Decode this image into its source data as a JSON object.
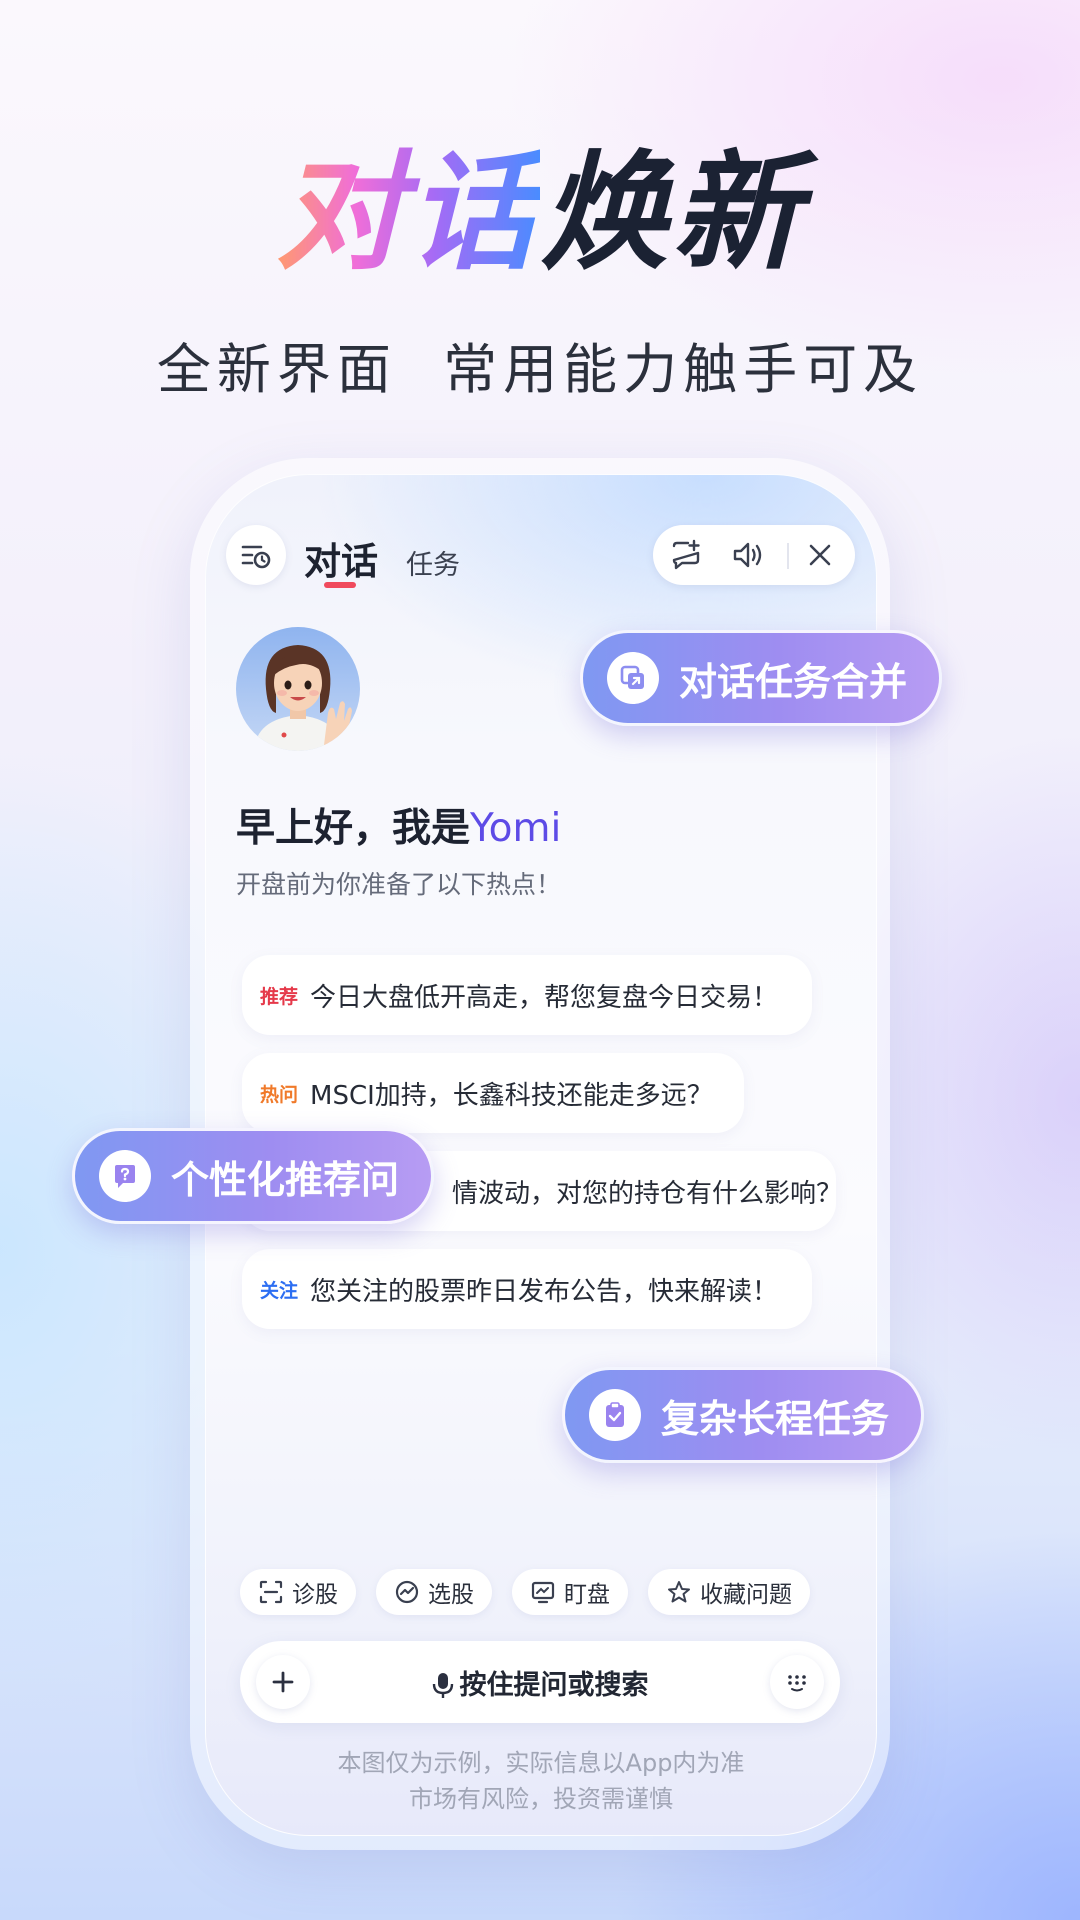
{
  "hero": {
    "title_gradient": "对话",
    "title_dark": "焕新",
    "subtitle": "全新界面  常用能力触手可及"
  },
  "header": {
    "tab_active": "对话",
    "tab_inactive": "任务",
    "history_icon": "history-list-icon",
    "new_chat_icon": "new-chat-icon",
    "speaker_icon": "speaker-icon",
    "close_icon": "close-icon"
  },
  "greeting": {
    "prefix": "早上好，我是",
    "name": "Yomi",
    "subtitle": "开盘前为你准备了以下热点！"
  },
  "suggestions": [
    {
      "tag": "推荐",
      "tag_color": "#e5394a",
      "text": "今日大盘低开高走，帮您复盘今日交易！"
    },
    {
      "tag": "热问",
      "tag_color": "#f07a2a",
      "text": "MSCI加持，长鑫科技还能走多远？"
    },
    {
      "tag": "",
      "tag_color": "#3c6cf0",
      "text": "情波动，对您的持仓有什么影响？"
    },
    {
      "tag": "关注",
      "tag_color": "#2c6ef2",
      "text": "您关注的股票昨日发布公告，快来解读！"
    }
  ],
  "chips": [
    {
      "label": "诊股",
      "icon": "scan-icon"
    },
    {
      "label": "选股",
      "icon": "radar-icon"
    },
    {
      "label": "盯盘",
      "icon": "monitor-icon"
    },
    {
      "label": "收藏问题",
      "icon": "star-icon"
    }
  ],
  "input": {
    "placeholder": "按住提问或搜索",
    "plus_icon": "plus-icon",
    "mic_icon": "mic-icon",
    "keyboard_icon": "keyboard-icon"
  },
  "disclaimer": {
    "line1": "本图仅为示例，实际信息以App内为准",
    "line2": "市场有风险，投资需谨慎"
  },
  "features": {
    "merge": "对话任务合并",
    "personalized": "个性化推荐问",
    "long_task": "复杂长程任务"
  },
  "colors": {
    "accent_red": "#f04a5d",
    "brand_purple": "#5d4be6",
    "feature_gradient_start": "#7f98f2",
    "feature_gradient_end": "#b79cf3"
  }
}
